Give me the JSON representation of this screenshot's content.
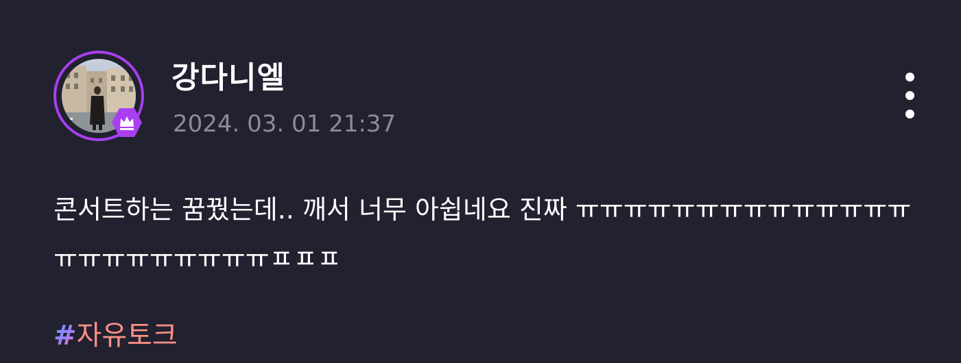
{
  "post": {
    "author": {
      "name": "강다니엘",
      "badge_icon": "crown-icon",
      "ring_color": "#a93ff0"
    },
    "timestamp": "2024. 03. 01 21:37",
    "more_icon": "vertical-ellipsis-icon",
    "body": "콘서트하는 꿈꿨는데.. 깨서 너무 아쉽네요 진짜 ㅠㅠㅠㅠㅠㅠㅠㅠㅠㅠㅠㅠㅠㅠㅠㅠㅠㅠㅠㅠㅠㅠㅠㅍㅍㅍ",
    "hashtag": {
      "symbol": "#",
      "label": "자유토크",
      "color": "#ff8f86"
    }
  }
}
